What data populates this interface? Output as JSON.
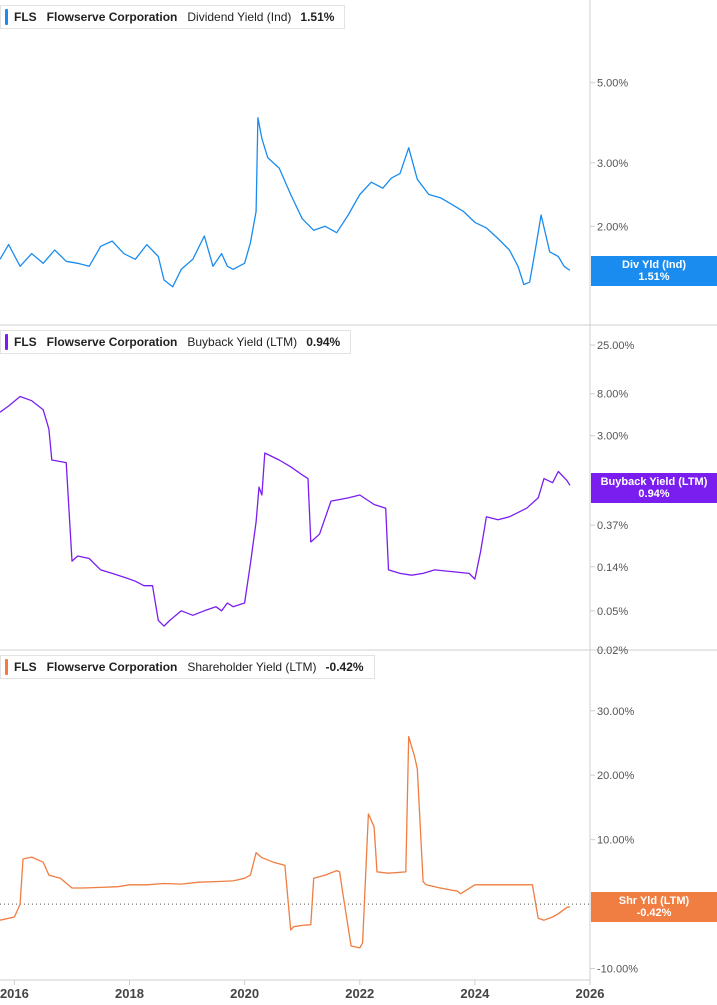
{
  "colors": {
    "dividend": "#1a8cf0",
    "buyback": "#7a1ef0",
    "shareholder": "#f07d41",
    "axis_text": "#555555",
    "panel_border": "#cfcfcf"
  },
  "x_axis": {
    "range": [
      2015.75,
      2026.0
    ],
    "ticks": [
      "2016",
      "2018",
      "2020",
      "2022",
      "2024",
      "2026"
    ],
    "tick_values": [
      2016,
      2018,
      2020,
      2022,
      2024,
      2026
    ]
  },
  "panels": [
    {
      "id": "dividend",
      "legend": {
        "ticker": "FLS",
        "company": "Flowserve Corporation",
        "metric": "Dividend Yield (Ind)",
        "value": "1.51%"
      },
      "flag": {
        "line1": "Div Yld (Ind)",
        "line2": "1.51%"
      }
    },
    {
      "id": "buyback",
      "legend": {
        "ticker": "FLS",
        "company": "Flowserve Corporation",
        "metric": "Buyback Yield (LTM)",
        "value": "0.94%"
      },
      "flag": {
        "line1": "Buyback Yield (LTM)",
        "line2": "0.94%"
      }
    },
    {
      "id": "shareholder",
      "legend": {
        "ticker": "FLS",
        "company": "Flowserve Corporation",
        "metric": "Shareholder Yield (LTM)",
        "value": "-0.42%"
      },
      "flag": {
        "line1": "Shr Yld (LTM)",
        "line2": "-0.42%"
      }
    }
  ],
  "chart_data": [
    {
      "type": "line",
      "scale": "log",
      "ylim": [
        1.1,
        7.0
      ],
      "y_ticks": [
        {
          "value": 2,
          "label": "2.00%"
        },
        {
          "value": 3,
          "label": "3.00%"
        },
        {
          "value": 5,
          "label": "5.00%"
        }
      ],
      "x": [
        2015.75,
        2015.9,
        2016.1,
        2016.3,
        2016.5,
        2016.7,
        2016.9,
        2017.1,
        2017.3,
        2017.5,
        2017.7,
        2017.9,
        2018.1,
        2018.3,
        2018.5,
        2018.6,
        2018.75,
        2018.9,
        2019.1,
        2019.3,
        2019.45,
        2019.6,
        2019.7,
        2019.8,
        2020.0,
        2020.1,
        2020.2,
        2020.23,
        2020.3,
        2020.4,
        2020.6,
        2020.8,
        2021.0,
        2021.2,
        2021.4,
        2021.6,
        2021.8,
        2022.0,
        2022.2,
        2022.4,
        2022.55,
        2022.7,
        2022.85,
        2023.0,
        2023.2,
        2023.4,
        2023.6,
        2023.8,
        2024.0,
        2024.2,
        2024.4,
        2024.6,
        2024.75,
        2024.85,
        2024.95,
        2025.05,
        2025.15,
        2025.3,
        2025.45,
        2025.55,
        2025.65
      ],
      "values": [
        1.62,
        1.78,
        1.55,
        1.68,
        1.58,
        1.72,
        1.6,
        1.58,
        1.55,
        1.76,
        1.82,
        1.68,
        1.62,
        1.78,
        1.65,
        1.42,
        1.36,
        1.52,
        1.62,
        1.88,
        1.55,
        1.68,
        1.55,
        1.52,
        1.58,
        1.8,
        2.2,
        4.0,
        3.5,
        3.1,
        2.9,
        2.45,
        2.1,
        1.95,
        2.0,
        1.92,
        2.15,
        2.45,
        2.65,
        2.55,
        2.72,
        2.8,
        3.3,
        2.7,
        2.45,
        2.4,
        2.3,
        2.2,
        2.05,
        1.98,
        1.85,
        1.72,
        1.55,
        1.38,
        1.4,
        1.72,
        2.15,
        1.7,
        1.65,
        1.55,
        1.51
      ],
      "series_name": "Dividend Yield (Ind)"
    },
    {
      "type": "line",
      "scale": "log",
      "ylim": [
        0.02,
        25
      ],
      "y_ticks": [
        {
          "value": 0.02,
          "label": "0.02%"
        },
        {
          "value": 0.05,
          "label": "0.05%"
        },
        {
          "value": 0.14,
          "label": "0.14%"
        },
        {
          "value": 0.37,
          "label": "0.37%"
        },
        {
          "value": 3,
          "label": "3.00%"
        },
        {
          "value": 8,
          "label": "8.00%"
        },
        {
          "value": 25,
          "label": "25.00%"
        }
      ],
      "x": [
        2015.75,
        2015.9,
        2016.1,
        2016.3,
        2016.5,
        2016.6,
        2016.65,
        2016.9,
        2017.0,
        2017.1,
        2017.3,
        2017.5,
        2017.7,
        2017.9,
        2018.1,
        2018.25,
        2018.4,
        2018.5,
        2018.6,
        2018.7,
        2018.9,
        2019.1,
        2019.3,
        2019.5,
        2019.6,
        2019.7,
        2019.8,
        2020.0,
        2020.1,
        2020.2,
        2020.25,
        2020.3,
        2020.35,
        2020.6,
        2020.8,
        2021.0,
        2021.1,
        2021.15,
        2021.3,
        2021.5,
        2021.8,
        2022.0,
        2022.25,
        2022.45,
        2022.5,
        2022.7,
        2022.9,
        2023.1,
        2023.3,
        2023.6,
        2023.9,
        2024.0,
        2024.1,
        2024.2,
        2024.4,
        2024.6,
        2024.9,
        2025.1,
        2025.2,
        2025.35,
        2025.45,
        2025.6,
        2025.65
      ],
      "values": [
        5.2,
        6.0,
        7.5,
        6.8,
        5.5,
        3.5,
        1.7,
        1.6,
        0.16,
        0.18,
        0.17,
        0.13,
        0.12,
        0.11,
        0.1,
        0.09,
        0.09,
        0.04,
        0.035,
        0.04,
        0.05,
        0.045,
        0.05,
        0.055,
        0.05,
        0.06,
        0.055,
        0.06,
        0.15,
        0.4,
        0.9,
        0.75,
        2.0,
        1.7,
        1.45,
        1.2,
        1.1,
        0.25,
        0.3,
        0.65,
        0.7,
        0.75,
        0.6,
        0.55,
        0.13,
        0.12,
        0.115,
        0.12,
        0.13,
        0.125,
        0.12,
        0.105,
        0.2,
        0.45,
        0.42,
        0.45,
        0.55,
        0.7,
        1.1,
        1.0,
        1.3,
        1.05,
        0.94
      ],
      "series_name": "Buyback Yield (LTM)"
    },
    {
      "type": "line",
      "scale": "linear",
      "ylim": [
        -11,
        34
      ],
      "y_ticks": [
        {
          "value": -10,
          "label": "-10.00%"
        },
        {
          "value": 0,
          "label": "0.00%"
        },
        {
          "value": 10,
          "label": "10.00%"
        },
        {
          "value": 20,
          "label": "20.00%"
        },
        {
          "value": 30,
          "label": "30.00%"
        }
      ],
      "x": [
        2015.75,
        2016.0,
        2016.05,
        2016.1,
        2016.15,
        2016.3,
        2016.5,
        2016.6,
        2016.8,
        2017.0,
        2017.2,
        2017.5,
        2017.8,
        2018.0,
        2018.3,
        2018.6,
        2018.9,
        2019.2,
        2019.5,
        2019.8,
        2020.0,
        2020.1,
        2020.2,
        2020.3,
        2020.5,
        2020.7,
        2020.8,
        2020.85,
        2021.0,
        2021.15,
        2021.2,
        2021.4,
        2021.6,
        2021.65,
        2021.7,
        2021.85,
        2022.0,
        2022.05,
        2022.15,
        2022.25,
        2022.3,
        2022.5,
        2022.8,
        2022.85,
        2022.95,
        2023.0,
        2023.1,
        2023.15,
        2023.4,
        2023.7,
        2023.75,
        2024.0,
        2024.3,
        2024.6,
        2024.9,
        2025.0,
        2025.1,
        2025.2,
        2025.35,
        2025.45,
        2025.6,
        2025.65
      ],
      "values": [
        -2.5,
        -2.0,
        -1.0,
        0.0,
        7.0,
        7.3,
        6.5,
        4.5,
        4.0,
        2.5,
        2.5,
        2.6,
        2.7,
        3.0,
        3.0,
        3.2,
        3.1,
        3.4,
        3.5,
        3.6,
        4.0,
        4.5,
        8.0,
        7.2,
        6.5,
        6.0,
        -4.0,
        -3.5,
        -3.3,
        -3.2,
        4.0,
        4.5,
        5.2,
        5.0,
        2.0,
        -6.5,
        -6.8,
        -6.0,
        14.0,
        12.0,
        5.0,
        4.8,
        5.0,
        26.0,
        23.0,
        21.0,
        3.5,
        3.0,
        2.5,
        2.0,
        1.6,
        3.0,
        3.0,
        3.0,
        3.0,
        3.0,
        -2.2,
        -2.5,
        -2.0,
        -1.5,
        -0.5,
        -0.42
      ],
      "series_name": "Shareholder Yield (LTM)"
    }
  ]
}
